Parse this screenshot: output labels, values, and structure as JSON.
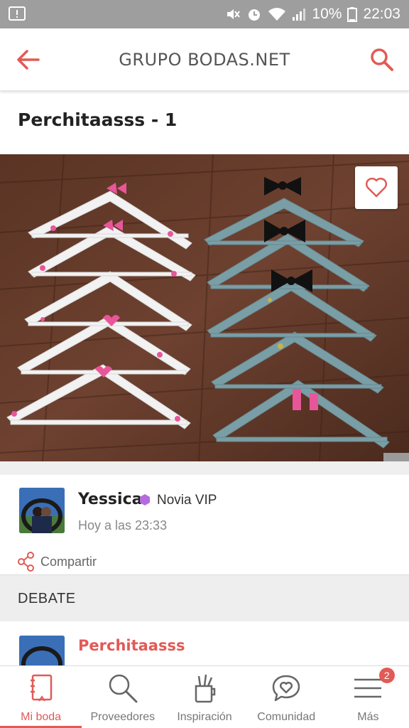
{
  "status_bar": {
    "battery": "10%",
    "time": "22:03",
    "icons": [
      "notification-icon",
      "mute-icon",
      "alarm-icon",
      "wifi-icon",
      "signal-icon",
      "battery-icon"
    ]
  },
  "header": {
    "title": "GRUPO BODAS.NET",
    "back_icon": "arrow-left-icon",
    "search_icon": "search-icon"
  },
  "post": {
    "title": "Perchitaasss - 1",
    "photo_subject": "decorated-hangers-photo",
    "favorite_icon": "heart-outline-icon"
  },
  "author": {
    "name": "Yessica",
    "badge": "Novia VIP",
    "badge_color": "#b36bde",
    "time": "Hoy a las 23:33",
    "share_label": "Compartir"
  },
  "debate": {
    "section_title": "DEBATE",
    "first_item_title": "Perchitaasss"
  },
  "bottom_nav": {
    "items": [
      {
        "label": "Mi boda",
        "icon": "notebook-icon",
        "active": true
      },
      {
        "label": "Proveedores",
        "icon": "search-icon",
        "active": false
      },
      {
        "label": "Inspiración",
        "icon": "pencil-cup-icon",
        "active": false
      },
      {
        "label": "Comunidad",
        "icon": "heart-chat-icon",
        "active": false
      },
      {
        "label": "Más",
        "icon": "menu-icon",
        "active": false,
        "badge": "2"
      }
    ]
  },
  "colors": {
    "accent": "#e25a55",
    "status_bar": "#9e9e9e",
    "section_bg": "#eeeeee"
  }
}
